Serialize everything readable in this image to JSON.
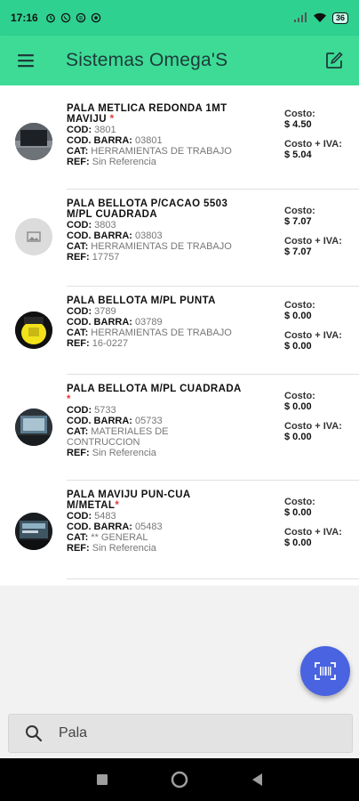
{
  "status_bar": {
    "time": "17:16",
    "battery": "36"
  },
  "app_bar": {
    "title": "Sistemas Omega'S"
  },
  "products": [
    {
      "name": "PALA METLICA REDONDA 1MT MAVIJU",
      "star": "*",
      "cod_label": "COD:",
      "cod": "3801",
      "barra_label": "COD. BARRA:",
      "barra": "03801",
      "cat_label": "CAT:",
      "cat": "HERRAMIENTAS DE TRABAJO",
      "ref_label": "REF:",
      "ref": "Sin Referencia",
      "costo_label": "Costo:",
      "costo": "$ 4.50",
      "costo_iva_label": "Costo + IVA:",
      "costo_iva": "$ 5.04",
      "avatar": "photo-dark"
    },
    {
      "name": "PALA BELLOTA P/CACAO 5503 M/PL CUADRADA",
      "star": "",
      "cod_label": "COD:",
      "cod": "3803",
      "barra_label": "COD. BARRA:",
      "barra": "03803",
      "cat_label": "CAT:",
      "cat": "HERRAMIENTAS DE TRABAJO",
      "ref_label": "REF:",
      "ref": "17757",
      "costo_label": "Costo:",
      "costo": "$ 7.07",
      "costo_iva_label": "Costo + IVA:",
      "costo_iva": "$ 7.07",
      "avatar": "image-placeholder-icon"
    },
    {
      "name": "PALA BELLOTA M/PL PUNTA",
      "star": "",
      "cod_label": "COD:",
      "cod": "3789",
      "barra_label": "COD. BARRA:",
      "barra": "03789",
      "cat_label": "CAT:",
      "cat": "HERRAMIENTAS DE TRABAJO",
      "ref_label": "REF:",
      "ref": "16-0227",
      "costo_label": "Costo:",
      "costo": "$ 0.00",
      "costo_iva_label": "Costo + IVA:",
      "costo_iva": "$ 0.00",
      "avatar": "photo-yellow"
    },
    {
      "name": "PALA BELLOTA M/PL CUADRADA",
      "star": "*",
      "cod_label": "COD:",
      "cod": "5733",
      "barra_label": "COD. BARRA:",
      "barra": "05733",
      "cat_label": "CAT:",
      "cat": "MATERIALES DE CONTRUCCION",
      "ref_label": "REF:",
      "ref": "Sin Referencia",
      "costo_label": "Costo:",
      "costo": "$ 0.00",
      "costo_iva_label": "Costo + IVA:",
      "costo_iva": "$ 0.00",
      "avatar": "photo-screen"
    },
    {
      "name": "PALA MAVIJU PUN-CUA M/METAL",
      "star": "*",
      "cod_label": "COD:",
      "cod": "5483",
      "barra_label": "COD. BARRA:",
      "barra": "05483",
      "cat_label": "CAT:",
      "cat": "** GENERAL",
      "ref_label": "REF:",
      "ref": "Sin Referencia",
      "costo_label": "Costo:",
      "costo": "$ 0.00",
      "costo_iva_label": "Costo + IVA:",
      "costo_iva": "$ 0.00",
      "avatar": "photo-screen"
    }
  ],
  "search": {
    "value": "Pala",
    "placeholder": ""
  },
  "colors": {
    "status_bar": "#2fd190",
    "app_bar": "#3ddb96",
    "fab": "#4a63e0",
    "star": "#e53935"
  }
}
